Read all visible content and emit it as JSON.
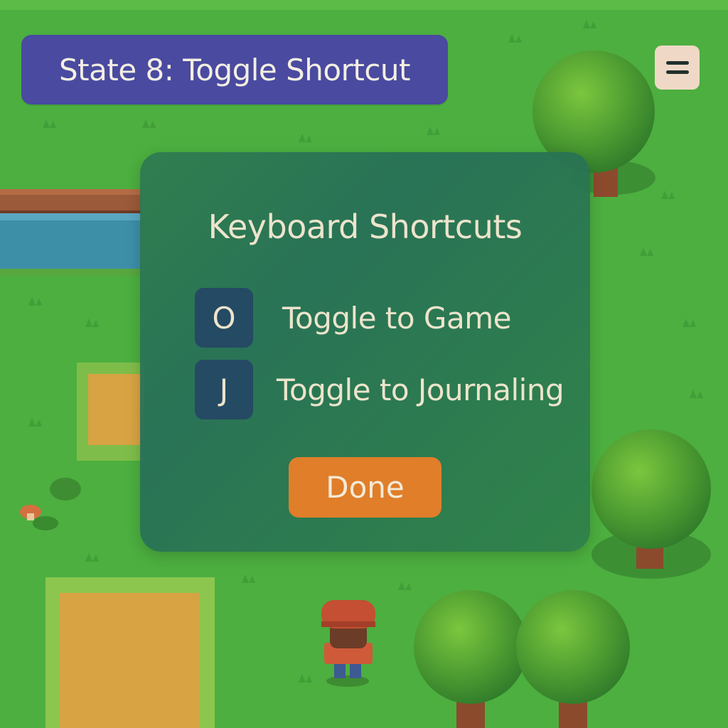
{
  "hud": {
    "state_banner": "State 8: Toggle Shortcut",
    "menu_icon": "hamburger-menu-icon"
  },
  "dialog": {
    "title": "Keyboard Shortcuts",
    "shortcuts": [
      {
        "key": "O",
        "label": "Toggle to Game"
      },
      {
        "key": "J",
        "label": "Toggle to Journaling"
      }
    ],
    "done_label": "Done"
  },
  "colors": {
    "grass": "#4caf3f",
    "banner": "#4a4aa0",
    "dialog": "#2e7a50",
    "key_cap": "#254a64",
    "done_button": "#e07e2a",
    "text_light": "#ece4cc"
  }
}
